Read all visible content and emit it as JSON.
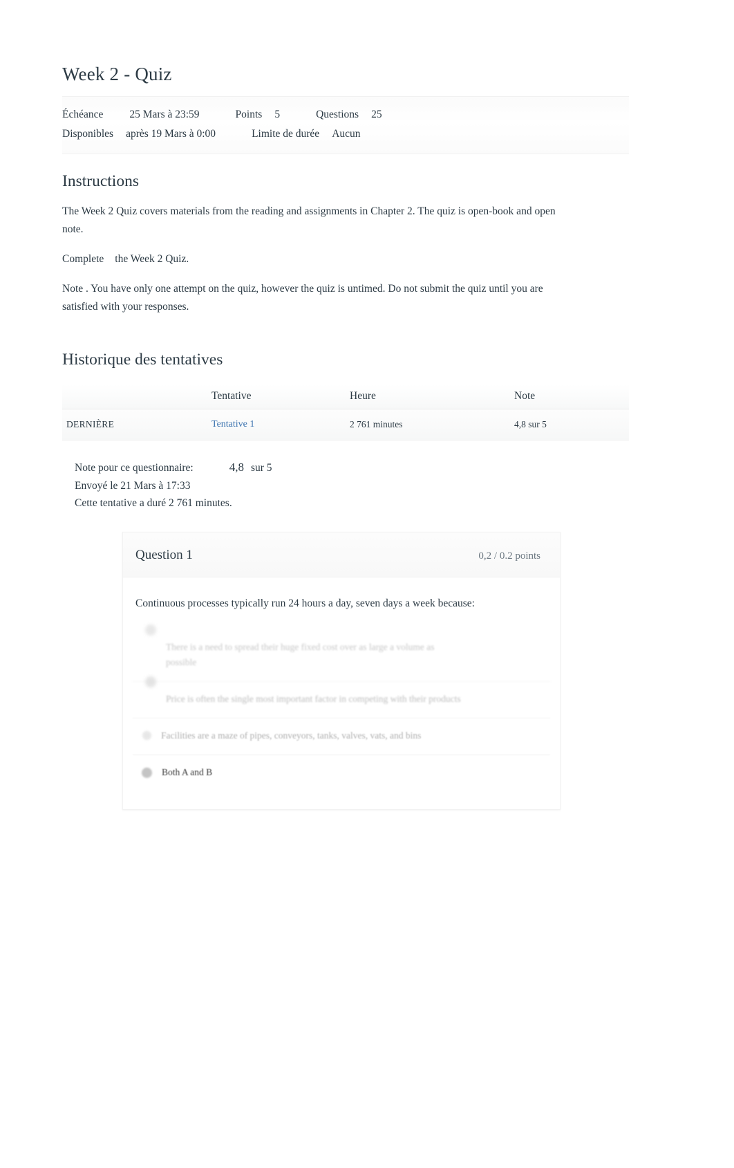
{
  "quiz": {
    "title": "Week 2 - Quiz",
    "meta": {
      "due_label": "Échéance",
      "due_value": "25 Mars à 23:59",
      "points_label": "Points",
      "points_value": "5",
      "questions_label": "Questions",
      "questions_value": "25",
      "available_label": "Disponibles",
      "available_value": "après 19 Mars à 0:00",
      "time_limit_label": "Limite de durée",
      "time_limit_value": "Aucun"
    }
  },
  "instructions": {
    "heading": "Instructions",
    "paragraphs": [
      "The Week 2 Quiz covers materials from the reading and assignments in Chapter 2. The quiz is open-book and open note.",
      "Complete",
      "the Week 2 Quiz.",
      "Note . You have only one attempt on the quiz, however the quiz is untimed. Do not submit the quiz until you are satisfied with your responses."
    ],
    "p2_part1": "Complete",
    "p2_part2": "the Week 2 Quiz.",
    "p1": "The Week 2 Quiz covers materials from the reading and assignments in Chapter 2. The quiz is open-book and open note.",
    "p3": "Note . You have only one attempt on the quiz, however the quiz is untimed. Do not submit the quiz until you are satisfied with your responses."
  },
  "attempts": {
    "heading": "Historique des tentatives",
    "columns": {
      "kept": "",
      "attempt": "Tentative",
      "time": "Heure",
      "score": "Note"
    },
    "rows": [
      {
        "kept": "DERNIÈRE",
        "attempt": "Tentative 1",
        "time": "2 761 minutes",
        "score": "4,8 sur 5"
      }
    ]
  },
  "score_summary": {
    "score_label": "Note pour ce questionnaire:",
    "score_value": "4,8",
    "score_out_of": "sur 5",
    "submitted": "Envoyé le 21 Mars à 17:33",
    "duration": "Cette tentative a duré 2 761 minutes."
  },
  "question": {
    "name": "Question 1",
    "points": "0,2 / 0.2 points",
    "text": "Continuous processes typically run 24 hours a day, seven days a week because:",
    "answers": [
      {
        "text": "There is a need to spread their huge fixed cost over as large a volume as possible"
      },
      {
        "text": "Price is often the single most important factor in competing with their products"
      },
      {
        "text": "Facilities are a maze of pipes, conveyors, tanks, valves, vats, and bins"
      },
      {
        "text": "Both A and B"
      }
    ]
  },
  "colors": {
    "link": "#3b73af",
    "text": "#2d3b45",
    "muted": "#6b7780"
  }
}
